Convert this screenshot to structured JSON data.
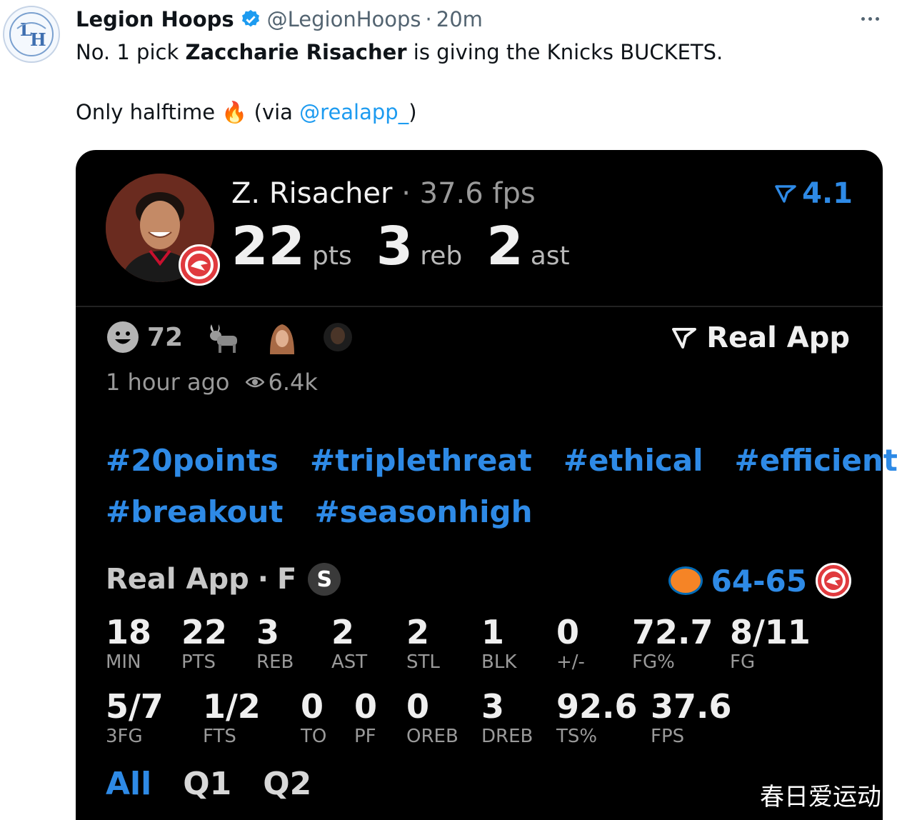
{
  "tweet": {
    "author_name": "Legion Hoops",
    "handle": "@LegionHoops",
    "separator": "·",
    "time": "20m",
    "line1_pre": "No. 1 pick ",
    "line1_bold": "Zaccharie Risacher",
    "line1_post": " is giving the Knicks BUCKETS.",
    "line2_pre": "Only halftime ",
    "line2_emoji": "🔥",
    "line2_mid": " (via ",
    "line2_mention": "@realapp_",
    "line2_post": ")"
  },
  "card": {
    "player_name": "Z. Risacher",
    "fps_label": " · 37.6 fps",
    "rating": "4.1",
    "big_stats": [
      {
        "value": "22",
        "unit": "pts"
      },
      {
        "value": "3",
        "unit": "reb"
      },
      {
        "value": "2",
        "unit": "ast"
      }
    ],
    "reaction_count": "72",
    "brand": "Real App",
    "posted": "1 hour ago",
    "views": "6.4k",
    "hashtags_row1": [
      "#20points",
      "#triplethreat",
      "#ethical",
      "#efficient"
    ],
    "hashtags_row2": [
      "#breakout",
      "#seasonhigh"
    ],
    "game_source": "Real App",
    "game_sep": "·",
    "game_status": "F",
    "game_badge": "S",
    "score": "64-65",
    "stats_row1": [
      {
        "value": "18",
        "label": "MIN"
      },
      {
        "value": "22",
        "label": "PTS"
      },
      {
        "value": "3",
        "label": "REB"
      },
      {
        "value": "2",
        "label": "AST"
      },
      {
        "value": "2",
        "label": "STL"
      },
      {
        "value": "1",
        "label": "BLK"
      },
      {
        "value": "0",
        "label": "+/-"
      },
      {
        "value": "72.7",
        "label": "FG%"
      },
      {
        "value": "8/11",
        "label": "FG"
      }
    ],
    "stats_row2": [
      {
        "value": "5/7",
        "label": "3FG"
      },
      {
        "value": "1/2",
        "label": "FTS"
      },
      {
        "value": "0",
        "label": "TO"
      },
      {
        "value": "0",
        "label": "PF"
      },
      {
        "value": "0",
        "label": "OREB"
      },
      {
        "value": "3",
        "label": "DREB"
      },
      {
        "value": "92.6",
        "label": "TS%"
      },
      {
        "value": "37.6",
        "label": "FPS"
      }
    ],
    "period_tabs": [
      {
        "label": "All",
        "active": true
      },
      {
        "label": "Q1",
        "active": false
      },
      {
        "label": "Q2",
        "active": false
      }
    ]
  },
  "watermark": "春日爱运动",
  "colors": {
    "link_blue": "#1d9bf0",
    "app_blue": "#2e8ae6",
    "card_bg": "#000000",
    "hawks_red": "#e03a3e"
  },
  "icons": [
    "legion-hoops-logo",
    "verified-badge-icon",
    "more-icon",
    "real-app-logo-icon",
    "smile-icon",
    "goat-icon",
    "eye-icon",
    "knicks-logo",
    "hawks-logo"
  ]
}
